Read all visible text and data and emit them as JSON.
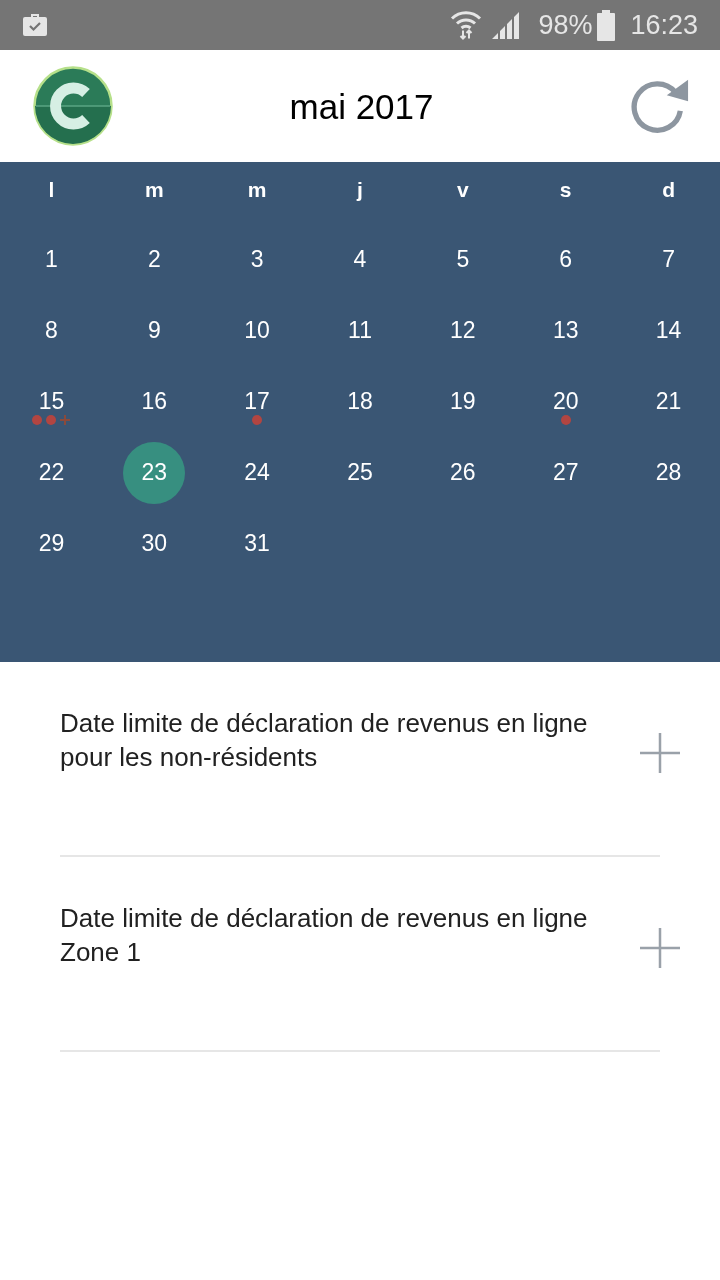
{
  "status_bar": {
    "battery": "98%",
    "time": "16:23"
  },
  "header": {
    "title": "mai 2017"
  },
  "calendar": {
    "weekdays": [
      "l",
      "m",
      "m",
      "j",
      "v",
      "s",
      "d"
    ],
    "weeks": [
      [
        {
          "day": "1",
          "selected": false
        },
        {
          "day": "2",
          "selected": false
        },
        {
          "day": "3",
          "selected": false
        },
        {
          "day": "4",
          "selected": false
        },
        {
          "day": "5",
          "selected": false
        },
        {
          "day": "6",
          "selected": false
        },
        {
          "day": "7",
          "selected": false
        }
      ],
      [
        {
          "day": "8",
          "selected": false
        },
        {
          "day": "9",
          "selected": false
        },
        {
          "day": "10",
          "selected": false
        },
        {
          "day": "11",
          "selected": false
        },
        {
          "day": "12",
          "selected": false
        },
        {
          "day": "13",
          "selected": false
        },
        {
          "day": "14",
          "selected": false
        }
      ],
      [
        {
          "day": "15",
          "selected": false,
          "markers": [
            {
              "kind": "dot"
            },
            {
              "kind": "dot"
            },
            {
              "kind": "more"
            }
          ]
        },
        {
          "day": "16",
          "selected": false
        },
        {
          "day": "17",
          "selected": false,
          "markers": [
            {
              "kind": "dot"
            }
          ]
        },
        {
          "day": "18",
          "selected": false
        },
        {
          "day": "19",
          "selected": false
        },
        {
          "day": "20",
          "selected": false,
          "markers": [
            {
              "kind": "dot"
            }
          ]
        },
        {
          "day": "21",
          "selected": false
        }
      ],
      [
        {
          "day": "22",
          "selected": false
        },
        {
          "day": "23",
          "selected": true
        },
        {
          "day": "24",
          "selected": false
        },
        {
          "day": "25",
          "selected": false
        },
        {
          "day": "26",
          "selected": false
        },
        {
          "day": "27",
          "selected": false
        },
        {
          "day": "28",
          "selected": false
        }
      ],
      [
        {
          "day": "29",
          "selected": false
        },
        {
          "day": "30",
          "selected": false
        },
        {
          "day": "31",
          "selected": false
        }
      ]
    ]
  },
  "events": [
    {
      "title": "Date limite de déclaration de revenus en ligne pour les non-résidents"
    },
    {
      "title": "Date limite de déclaration de revenus en ligne Zone 1"
    }
  ]
}
